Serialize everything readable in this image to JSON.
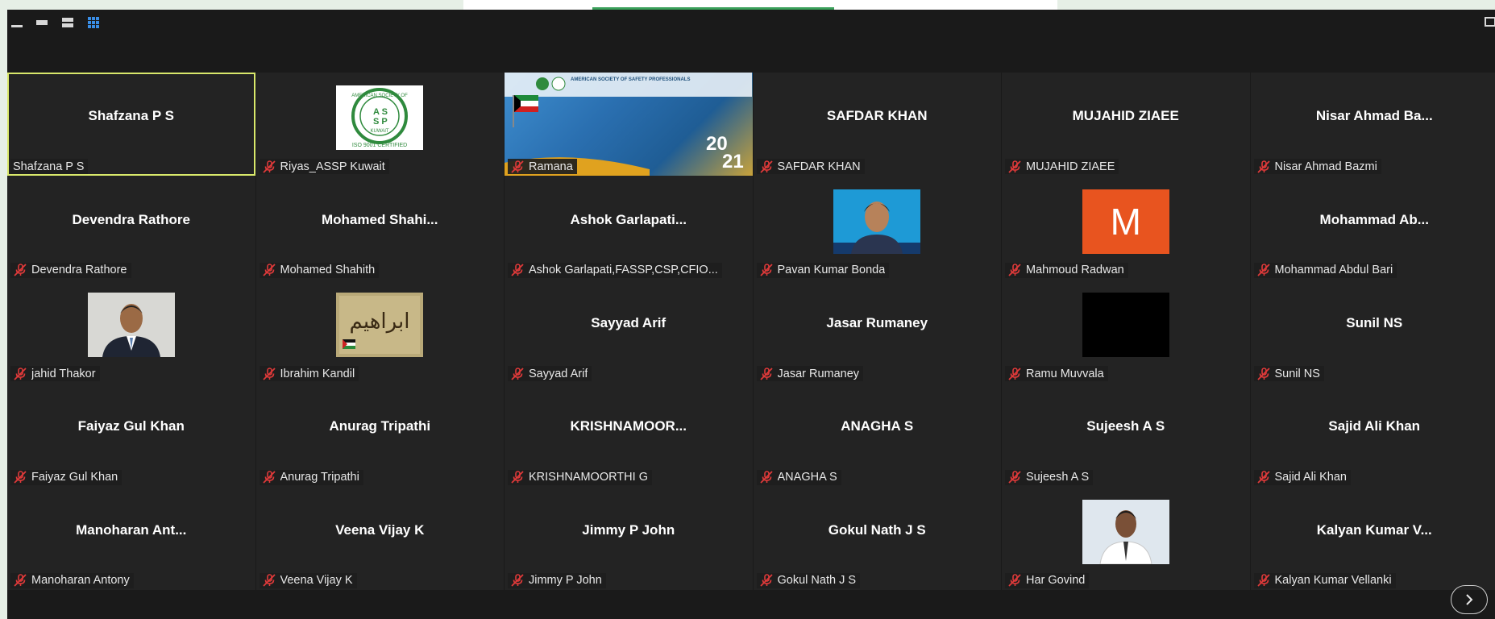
{
  "colors": {
    "accent": "#d9e86b",
    "muted": "#e03a3a",
    "tile_bg": "#232323",
    "window_bg": "#1a1a1a"
  },
  "toolbar": {
    "views": [
      {
        "icon": "minimize-view-icon"
      },
      {
        "icon": "strip-view-icon"
      },
      {
        "icon": "stack-view-icon"
      },
      {
        "icon": "gallery-view-icon",
        "selected": true
      }
    ]
  },
  "participants": [
    {
      "name": "Shafzana P S",
      "label": "Shafzana P S",
      "muted": false,
      "active": true
    },
    {
      "name": "",
      "label": "Riyas_ASSP Kuwait",
      "muted": true,
      "avatar": "assp-logo",
      "logo_text": {
        "top": "AMERICAN SOCIETY OF",
        "middle": "KUWAIT",
        "bottom": "ISO 9001 CERTIFIED"
      }
    },
    {
      "name": "",
      "label": "Ramana",
      "muted": true,
      "avatar": "shared-screen",
      "screen_text": {
        "org": "AMERICAN SOCIETY OF SAFETY PROFESSIONALS",
        "year_top": "20",
        "year_bottom": "21"
      }
    },
    {
      "name": "SAFDAR KHAN",
      "label": "SAFDAR KHAN",
      "muted": true
    },
    {
      "name": "MUJAHID ZIAEE",
      "label": "MUJAHID ZIAEE",
      "muted": true
    },
    {
      "name": "Nisar Ahmad Ba...",
      "label": "Nisar Ahmad Bazmi",
      "muted": true
    },
    {
      "name": "Devendra Rathore",
      "label": "Devendra Rathore",
      "muted": true
    },
    {
      "name": "Mohamed  Shahi...",
      "label": "Mohamed Shahith",
      "muted": true
    },
    {
      "name": "Ashok  Garlapati...",
      "label": "Ashok Garlapati,FASSP,CSP,CFIO...",
      "muted": true
    },
    {
      "name": "",
      "label": "Pavan Kumar Bonda",
      "muted": true,
      "avatar": "photo-blue"
    },
    {
      "name": "",
      "label": "Mahmoud Radwan",
      "muted": true,
      "avatar": "letter",
      "letter": "M"
    },
    {
      "name": "Mohammad  Ab...",
      "label": "Mohammad Abdul Bari",
      "muted": true
    },
    {
      "name": "",
      "label": "jahid Thakor",
      "muted": true,
      "avatar": "photo-suit"
    },
    {
      "name": "",
      "label": "Ibrahim Kandil",
      "muted": true,
      "avatar": "arabic-logo",
      "logo_text": "ابراهيم"
    },
    {
      "name": "Sayyad Arif",
      "label": "Sayyad Arif",
      "muted": true
    },
    {
      "name": "Jasar Rumaney",
      "label": "Jasar Rumaney",
      "muted": true
    },
    {
      "name": "",
      "label": "Ramu Muvvala",
      "muted": true,
      "avatar": "black"
    },
    {
      "name": "Sunil NS",
      "label": "Sunil NS",
      "muted": true
    },
    {
      "name": "Faiyaz Gul Khan",
      "label": "Faiyaz Gul Khan",
      "muted": true
    },
    {
      "name": "Anurag Tripathi",
      "label": "Anurag Tripathi",
      "muted": true
    },
    {
      "name": "KRISHNAMOOR...",
      "label": "KRISHNAMOORTHI G",
      "muted": true
    },
    {
      "name": "ANAGHA S",
      "label": "ANAGHA S",
      "muted": true
    },
    {
      "name": "Sujeesh A S",
      "label": "Sujeesh A S",
      "muted": true
    },
    {
      "name": "Sajid Ali Khan",
      "label": "Sajid Ali Khan",
      "muted": true
    },
    {
      "name": "Manoharan  Ant...",
      "label": "Manoharan Antony",
      "muted": true
    },
    {
      "name": "Veena Vijay K",
      "label": "Veena Vijay K",
      "muted": true
    },
    {
      "name": "Jimmy P John",
      "label": "Jimmy P John",
      "muted": true
    },
    {
      "name": "Gokul Nath J S",
      "label": "Gokul Nath J S",
      "muted": true
    },
    {
      "name": "",
      "label": "Har Govind",
      "muted": true,
      "avatar": "photo-white"
    },
    {
      "name": "Kalyan Kumar V...",
      "label": "Kalyan Kumar Vellanki",
      "muted": true
    }
  ],
  "navigation": {
    "next_icon": "chevron-right-icon"
  }
}
